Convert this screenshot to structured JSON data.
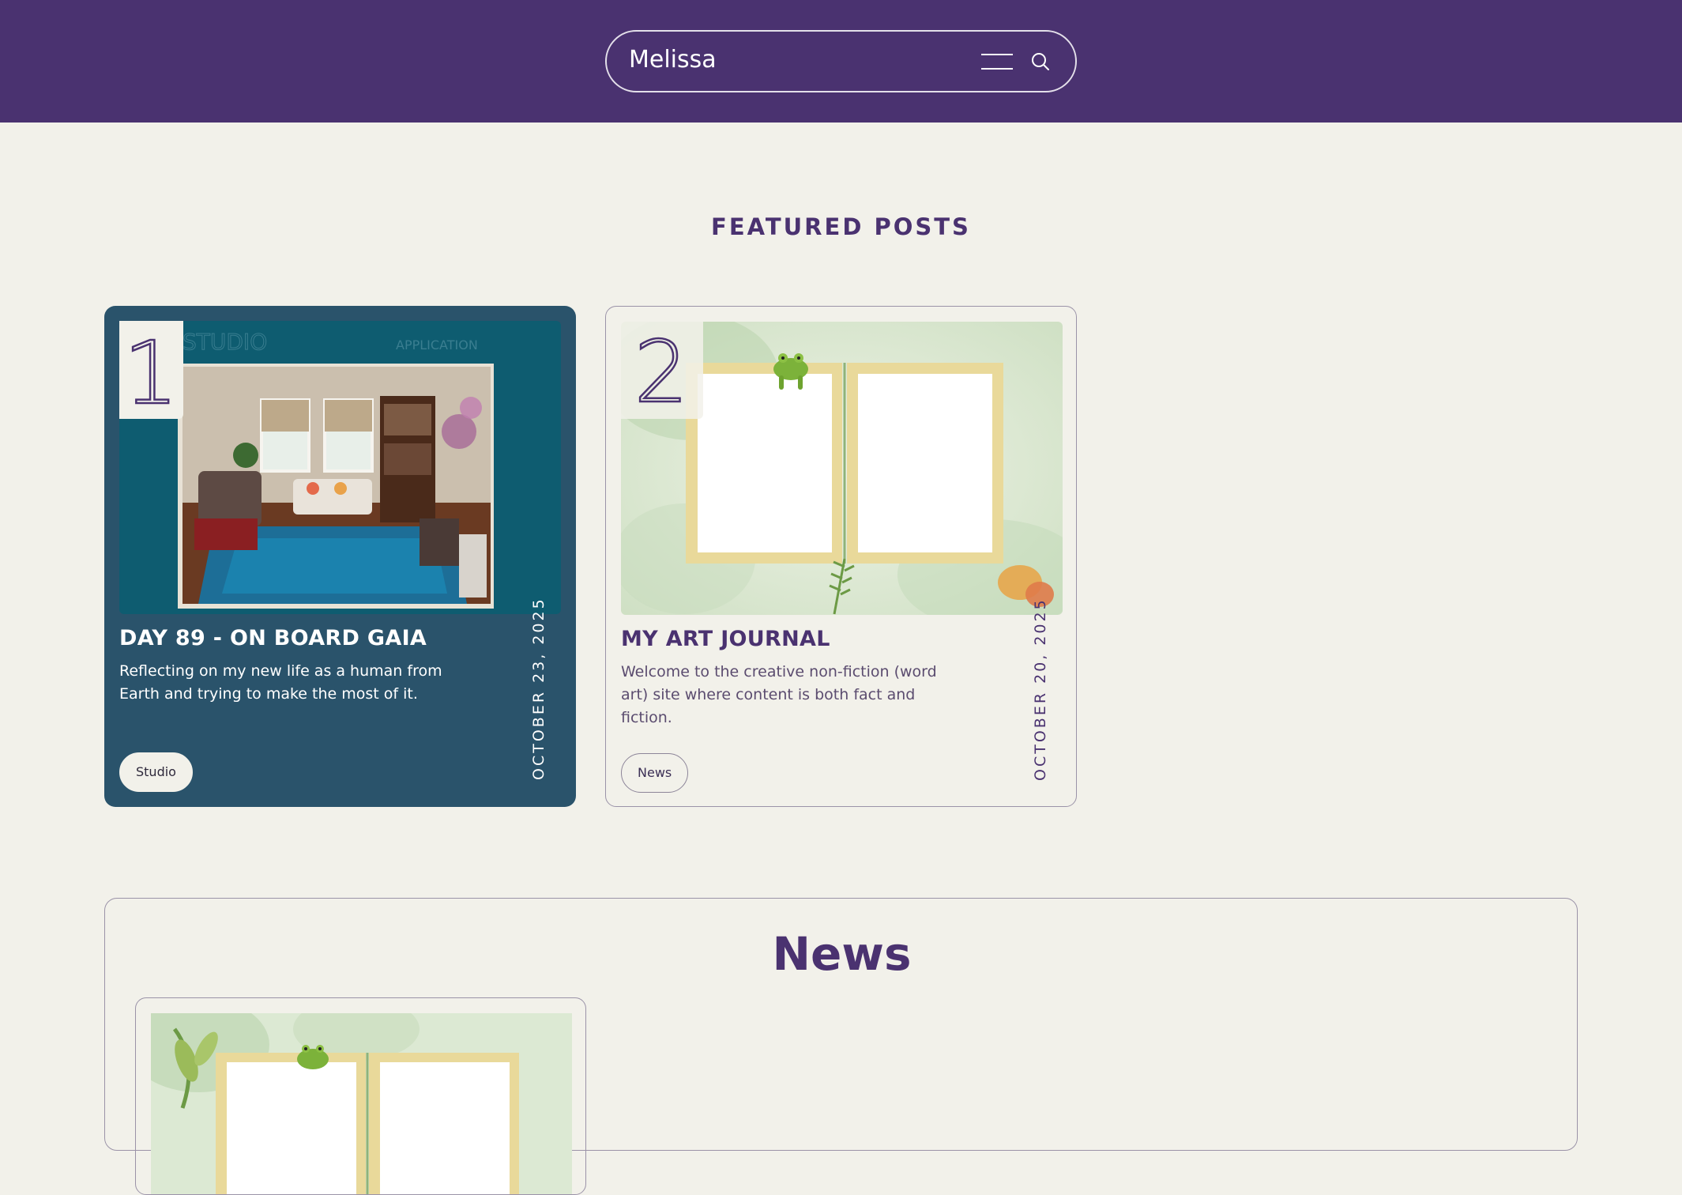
{
  "header": {
    "site_name": "Melissa",
    "menu_icon": "hamburger-menu-icon",
    "search_icon": "search-icon",
    "background": "#4a3270"
  },
  "featured": {
    "heading": "FEATURED POSTS",
    "posts": [
      {
        "number": "1",
        "title": "DAY 89 - ON BOARD GAIA",
        "excerpt": "Reflecting on my new life as a human from Earth and trying to make the most of it.",
        "date": "OCTOBER 23, 2025",
        "tag": "Studio",
        "image_sign_left": "STUDIO",
        "image_sign_right": "APPLICATION",
        "card_color": "#2a536b"
      },
      {
        "number": "2",
        "title": "MY ART JOURNAL",
        "excerpt": "Welcome to the creative non-fiction (word art) site where content is both fact and fiction.",
        "date": "OCTOBER 20, 2025",
        "tag": "News",
        "card_color": "#f2f1ea"
      }
    ]
  },
  "news": {
    "heading": "News"
  },
  "colors": {
    "accent": "#4a3270",
    "page_background": "#f2f1ea",
    "teal_card": "#2a536b"
  }
}
